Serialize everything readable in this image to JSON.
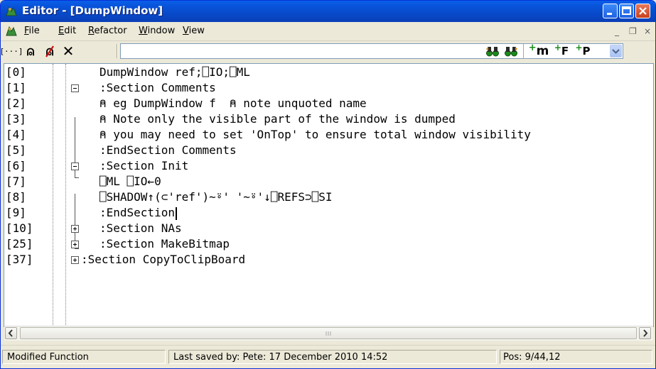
{
  "window": {
    "title": "Editor - [DumpWindow]",
    "app_icon": "editor-app-icon",
    "controls": [
      "minimize-icon",
      "maximize-icon",
      "close-icon"
    ]
  },
  "menu": {
    "items": [
      {
        "first": "F",
        "rest": "ile"
      },
      {
        "first": "E",
        "rest": "dit"
      },
      {
        "first": "R",
        "rest": "efactor"
      },
      {
        "first": "W",
        "rest": "indow"
      },
      {
        "first": "V",
        "rest": "iew"
      }
    ],
    "mdi_minimize": "_",
    "mdi_restore": "❐",
    "mdi_close": "×"
  },
  "toolbar": {
    "format_button": "[···]",
    "comment_button": "⍝",
    "uncomment_button": "⍝",
    "delete_button": "✕",
    "search_value": "",
    "search_placeholder": "",
    "find_prev_icon": "binoculars-prev-icon",
    "find_next_icon": "binoculars-next-icon",
    "new_method_label": "m",
    "new_function_label": "F",
    "new_property_label": "P"
  },
  "code": {
    "lines": [
      {
        "num": "[0]",
        "text": "DumpWindow ref;⎕IO;⎕ML"
      },
      {
        "num": "[1]",
        "text": ":Section Comments"
      },
      {
        "num": "[2]",
        "text": "⍝ eg DumpWindow f  ⍝ note unquoted name"
      },
      {
        "num": "[3]",
        "text": "⍝ Note only the visible part of the window is dumped"
      },
      {
        "num": "[4]",
        "text": "⍝ you may need to set 'OnTop' to ensure total window visibility"
      },
      {
        "num": "[5]",
        "text": ":EndSection Comments"
      },
      {
        "num": "[6]",
        "text": ":Section Init"
      },
      {
        "num": "[7]",
        "text": "⎕ML ⎕IO←0"
      },
      {
        "num": "[8]",
        "text": "⎕SHADOW↑(⊂'ref')~⍤' '~⍤'↓⎕REFS⊃⎕SI"
      },
      {
        "num": "[9]",
        "text": ":EndSection"
      },
      {
        "num": "[10]",
        "text": ":Section NAs"
      },
      {
        "num": "[25]",
        "text": ":Section MakeBitmap"
      },
      {
        "num": "[37]",
        "text": ":Section CopyToClipBoard"
      }
    ]
  },
  "status": {
    "state": "Modified Function",
    "saved": "Last saved by: Pete: 17 December 2010 14:52",
    "position": "Pos: 9/44,12"
  },
  "colors": {
    "titlebar": "#0a5fe9",
    "accent_red": "#d01010",
    "find_green": "#1a8a1a"
  }
}
